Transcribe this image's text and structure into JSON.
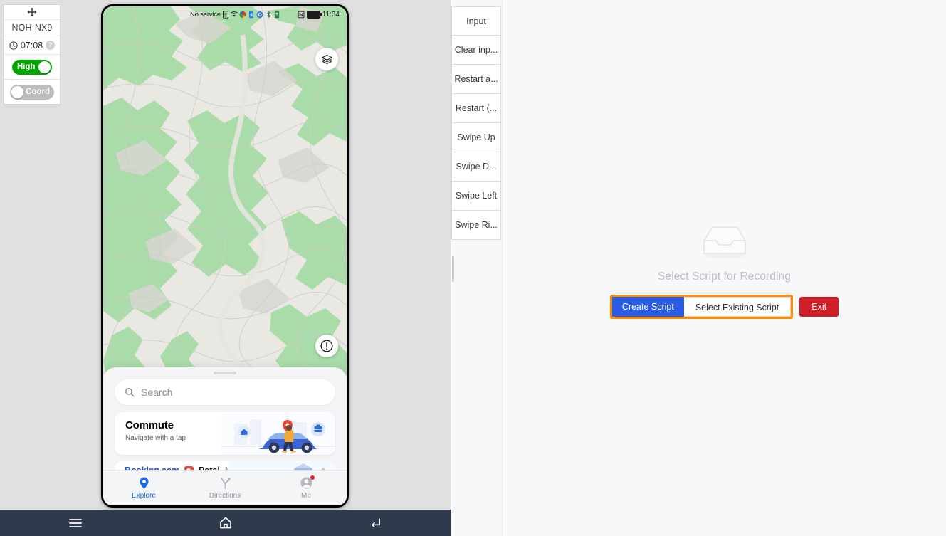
{
  "device_panel": {
    "drag_handle_icon": "move-cross-icon",
    "device_name": "NOH-NX9",
    "clock_icon": "clock-icon",
    "time": "07:08",
    "help_icon": "?",
    "quality_toggle": {
      "label": "High",
      "state": "on"
    },
    "coord_toggle": {
      "label": "Coord",
      "state": "off"
    }
  },
  "phone": {
    "status_bar": {
      "carrier": "No service",
      "icons": [
        "sim-icon",
        "wifi-icon",
        "app-color-icon",
        "download-icon",
        "globe-icon",
        "bluetooth-icon",
        "vpn-icon",
        "nfc-icon"
      ],
      "battery_icon": "battery-icon",
      "time": "11:34"
    },
    "map": {
      "layers_button_icon": "layers-icon",
      "warning_button_icon": "exclamation-circle-icon",
      "land_color": "#eae8e3",
      "forest_color": "#a9dca9",
      "shade_color": "#d6d4cf"
    },
    "sheet": {
      "search": {
        "icon": "search-icon",
        "placeholder": "Search"
      },
      "commute_card": {
        "title": "Commute",
        "subtitle": "Navigate with a tap",
        "illustration": "commute-car-illustration"
      },
      "partner_card": {
        "booking_label": "Booking.com",
        "petal_icon": "petal-maps-icon",
        "petal_label": "Petal",
        "maps_label": "Maps"
      }
    },
    "tabs": [
      {
        "label": "Explore",
        "icon": "map-pin-icon",
        "active": true,
        "badge": false
      },
      {
        "label": "Directions",
        "icon": "directions-arrow-icon",
        "active": false,
        "badge": false
      },
      {
        "label": "Me",
        "icon": "person-avatar-icon",
        "active": false,
        "badge": true
      }
    ]
  },
  "android_navbar": {
    "recents_icon": "hamburger-recents-icon",
    "home_icon": "home-icon",
    "back_icon": "back-icon",
    "background": "#2f3b4d"
  },
  "toolbar": {
    "buttons": [
      {
        "label": "Input"
      },
      {
        "label": "Clear inp..."
      },
      {
        "label": "Restart a..."
      },
      {
        "label": "Restart (..."
      },
      {
        "label": "Swipe Up"
      },
      {
        "label": "Swipe D..."
      },
      {
        "label": "Swipe Left"
      },
      {
        "label": "Swipe Ri..."
      }
    ],
    "scrollbar": "vertical-scrollbar"
  },
  "right_pane": {
    "empty_icon": "empty-inbox-icon",
    "title": "Select Script for Recording",
    "create_script_label": "Create Script",
    "select_existing_label": "Select Existing Script",
    "exit_label": "Exit",
    "highlight_color": "#ff8c00",
    "primary_color": "#2b5ce6",
    "danger_color": "#cf2027"
  }
}
